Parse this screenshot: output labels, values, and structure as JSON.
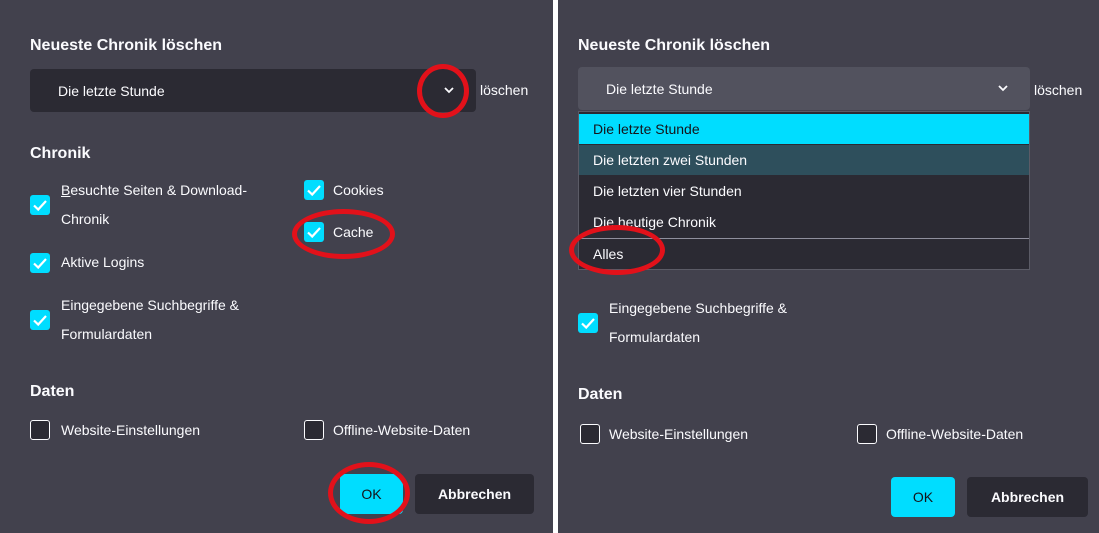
{
  "dialog_title": "Neueste Chronik löschen",
  "time_range": {
    "selected": "Die letzte Stunde",
    "clear_label": "löschen",
    "options": [
      "Die letzte Stunde",
      "Die letzten zwei Stunden",
      "Die letzten vier Stunden",
      "Die heutige Chronik",
      "Alles"
    ]
  },
  "history_section": {
    "heading": "Chronik",
    "items": {
      "browsing_line1": "Besuchte Seiten & Download-",
      "browsing_line2": "Chronik",
      "cookies": "Cookies",
      "cache": "Cache",
      "active_logins": "Aktive Logins",
      "form_line1": "Eingegebene Suchbegriffe &",
      "form_line2": "Formulardaten"
    },
    "checked": {
      "browsing": true,
      "cookies": true,
      "cache": true,
      "active_logins": true,
      "form": true
    }
  },
  "data_section": {
    "heading": "Daten",
    "site_settings": "Website-Einstellungen",
    "offline_data": "Offline-Website-Daten",
    "checked": {
      "site_settings": false,
      "offline_data": false
    }
  },
  "buttons": {
    "ok": "OK",
    "cancel": "Abbrechen"
  },
  "colors": {
    "dialog_bg": "#42414d",
    "field_bg": "#2b2a33",
    "accent": "#00ddff",
    "highlight_ring": "#e2111a"
  }
}
